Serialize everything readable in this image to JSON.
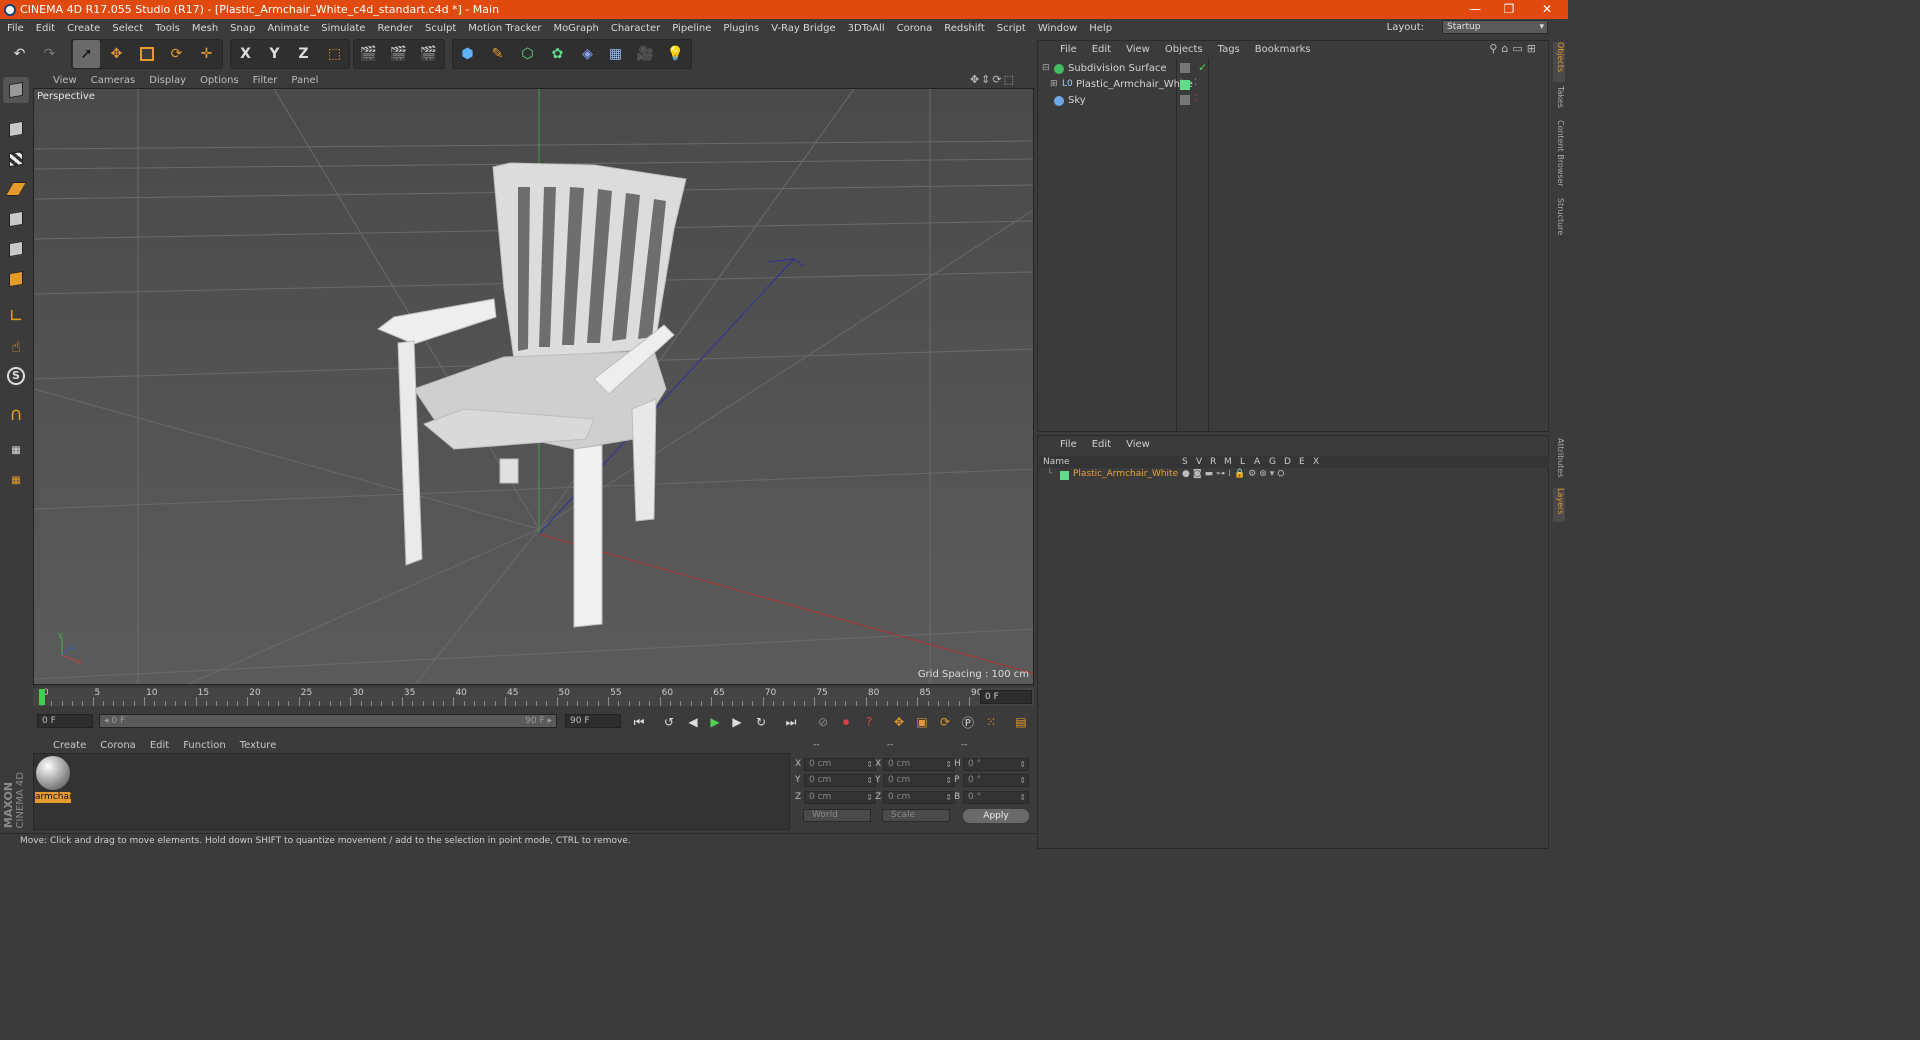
{
  "window": {
    "title": "CINEMA 4D R17.055 Studio (R17) - [Plastic_Armchair_White_c4d_standart.c4d *] - Main",
    "controls": [
      "—",
      "❐",
      "✕"
    ]
  },
  "menubar": {
    "items": [
      "File",
      "Edit",
      "Create",
      "Select",
      "Tools",
      "Mesh",
      "Snap",
      "Animate",
      "Simulate",
      "Render",
      "Sculpt",
      "Motion Tracker",
      "MoGraph",
      "Character",
      "Pipeline",
      "Plugins",
      "V-Ray Bridge",
      "3DToAll",
      "Corona",
      "Redshift",
      "Script",
      "Window",
      "Help"
    ],
    "layout_label": "Layout:",
    "layout_value": "Startup"
  },
  "toolbar": {
    "axis_x": "X",
    "axis_y": "Y",
    "axis_z": "Z"
  },
  "viewport": {
    "menu": [
      "View",
      "Cameras",
      "Display",
      "Options",
      "Filter",
      "Panel"
    ],
    "camera_label": "Perspective",
    "grid_spacing": "Grid Spacing : 100 cm",
    "nav_icons": [
      "move-view-icon",
      "dolly-icon",
      "rotate-view-icon",
      "maximize-icon"
    ]
  },
  "timeline": {
    "ticks": [
      "0",
      "5",
      "10",
      "15",
      "20",
      "25",
      "30",
      "35",
      "40",
      "45",
      "50",
      "55",
      "60",
      "65",
      "70",
      "75",
      "80",
      "85",
      "90"
    ],
    "end_frame": "0 F"
  },
  "playback": {
    "start_field": "0 F",
    "range_left": "◂ 0 F",
    "range_right": "90 F ▸",
    "end_field": "90 F"
  },
  "material_manager": {
    "menu": [
      "Create",
      "Corona",
      "Edit",
      "Function",
      "Texture"
    ],
    "material_name": "armchai"
  },
  "coordinates": {
    "headers": [
      "--",
      "--",
      "--"
    ],
    "rows": [
      {
        "a": "X",
        "av": "0 cm",
        "b": "X",
        "bv": "0 cm",
        "c": "H",
        "cv": "0 °"
      },
      {
        "a": "Y",
        "av": "0 cm",
        "b": "Y",
        "bv": "0 cm",
        "c": "P",
        "cv": "0 °"
      },
      {
        "a": "Z",
        "av": "0 cm",
        "b": "Z",
        "bv": "0 cm",
        "c": "B",
        "cv": "0 °"
      }
    ],
    "world": "World",
    "scale": "Scale",
    "apply": "Apply"
  },
  "status": {
    "text": "Move: Click and drag to move elements. Hold down SHIFT to quantize movement / add to the selection in point mode, CTRL to remove."
  },
  "objects_panel": {
    "menu": [
      "File",
      "Edit",
      "View",
      "Objects",
      "Tags",
      "Bookmarks"
    ],
    "objects": [
      {
        "name": "Subdivision Surface",
        "color": "#3fbf5f"
      },
      {
        "name": "Plastic_Armchair_White",
        "color": "#9fd0ff"
      },
      {
        "name": "Sky",
        "color": "#6ea8e8"
      }
    ]
  },
  "layers_panel": {
    "menu": [
      "File",
      "Edit",
      "View"
    ],
    "columns": [
      "Name",
      "S",
      "V",
      "R",
      "M",
      "L",
      "A",
      "G",
      "D",
      "E",
      "X"
    ],
    "layers": [
      {
        "name": "Plastic_Armchair_White",
        "color": "#5fdc8a"
      }
    ]
  },
  "side_tabs": [
    "Objects",
    "Takes",
    "Content Browser",
    "Structure",
    "Attributes",
    "Layers"
  ],
  "branding": {
    "maxon": "MAXON",
    "cinema": "CINEMA 4D"
  },
  "colors": {
    "accent": "#e04a0f",
    "selection": "#e59a2c",
    "object_label": "#e8a33a"
  }
}
